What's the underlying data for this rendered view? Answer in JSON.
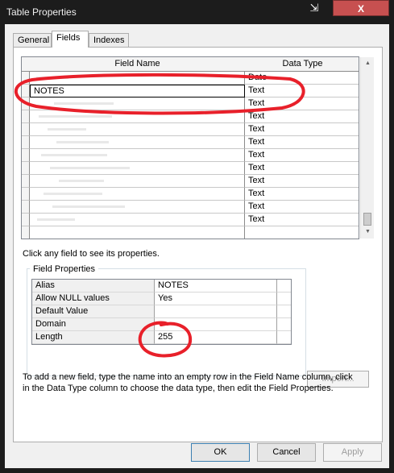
{
  "window": {
    "title": "Table Properties",
    "pin_glyph": "⇲",
    "close_glyph": "X"
  },
  "tabs": [
    {
      "label": "General",
      "active": false
    },
    {
      "label": "Fields",
      "active": true
    },
    {
      "label": "Indexes",
      "active": false
    }
  ],
  "fields_grid": {
    "headers": {
      "field_name": "Field Name",
      "data_type": "Data Type"
    },
    "rows": [
      {
        "name": "",
        "type": "Date",
        "selected": false
      },
      {
        "name": "NOTES",
        "type": "Text",
        "selected": true
      },
      {
        "name": "",
        "type": "Text",
        "selected": false
      },
      {
        "name": "",
        "type": "Text",
        "selected": false
      },
      {
        "name": "",
        "type": "Text",
        "selected": false
      },
      {
        "name": "",
        "type": "Text",
        "selected": false
      },
      {
        "name": "",
        "type": "Text",
        "selected": false
      },
      {
        "name": "",
        "type": "Text",
        "selected": false
      },
      {
        "name": "",
        "type": "Text",
        "selected": false
      },
      {
        "name": "",
        "type": "Text",
        "selected": false
      },
      {
        "name": "",
        "type": "Text",
        "selected": false
      },
      {
        "name": "",
        "type": "Text",
        "selected": false
      },
      {
        "name": "",
        "type": "",
        "selected": false
      }
    ]
  },
  "hint_text": "Click any field to see its properties.",
  "field_properties": {
    "legend": "Field Properties",
    "rows": [
      {
        "label": "Alias",
        "value": "NOTES"
      },
      {
        "label": "Allow NULL values",
        "value": "Yes"
      },
      {
        "label": "Default Value",
        "value": ""
      },
      {
        "label": "Domain",
        "value": ""
      },
      {
        "label": "Length",
        "value": "255"
      }
    ]
  },
  "import_button": "Import...",
  "description": "To add a new field, type the name into an empty row in the Field Name column, click in the Data Type column to choose the data type, then edit the Field Properties.",
  "buttons": {
    "ok": "OK",
    "cancel": "Cancel",
    "apply": "Apply"
  },
  "colors": {
    "annotation_red": "#e8202a",
    "close_red": "#c75050"
  }
}
